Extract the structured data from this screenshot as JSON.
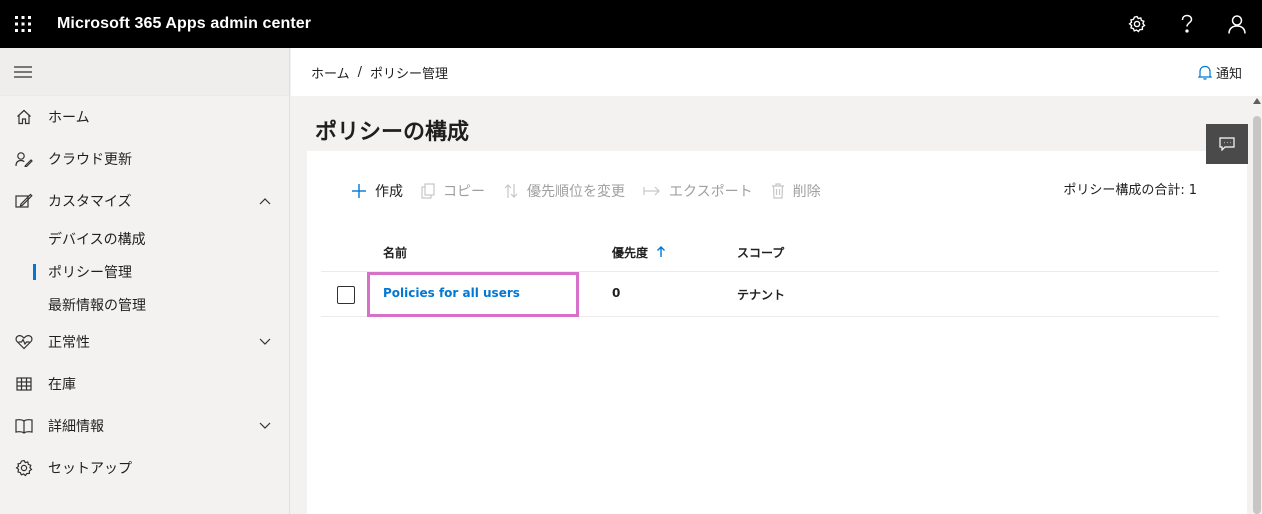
{
  "header": {
    "app_title": "Microsoft 365 Apps admin center",
    "icons": [
      "app-launcher-icon",
      "settings-icon",
      "help-icon",
      "account-icon"
    ]
  },
  "sidebar": {
    "items": [
      {
        "label": "ホーム",
        "icon": "home-icon"
      },
      {
        "label": "クラウド更新",
        "icon": "cloud-update-icon"
      },
      {
        "label": "カスタマイズ",
        "icon": "customize-icon",
        "expanded": true
      },
      {
        "label": "正常性",
        "icon": "health-icon"
      },
      {
        "label": "在庫",
        "icon": "inventory-icon"
      },
      {
        "label": "詳細情報",
        "icon": "book-icon"
      },
      {
        "label": "セットアップ",
        "icon": "setup-icon"
      }
    ],
    "subitems": [
      {
        "label": "デバイスの構成"
      },
      {
        "label": "ポリシー管理",
        "active": true
      },
      {
        "label": "最新情報の管理"
      }
    ]
  },
  "breadcrumb": {
    "home": "ホーム",
    "separator": "/",
    "current": "ポリシー管理"
  },
  "notify": {
    "label": "通知"
  },
  "page": {
    "title": "ポリシーの構成"
  },
  "commands": {
    "create": "作成",
    "copy": "コピー",
    "reorder": "優先順位を変更",
    "export": "エクスポート",
    "delete": "削除"
  },
  "total": {
    "label": "ポリシー構成の合計:",
    "value": "1"
  },
  "table": {
    "columns": {
      "name": "名前",
      "priority": "優先度",
      "scope": "スコープ"
    },
    "rows": [
      {
        "name": "Policies for all users",
        "priority": "0",
        "scope": "テナント"
      }
    ]
  },
  "colors": {
    "accent": "#0078d4",
    "highlight": "#d670c8",
    "topbar": "#000000"
  }
}
